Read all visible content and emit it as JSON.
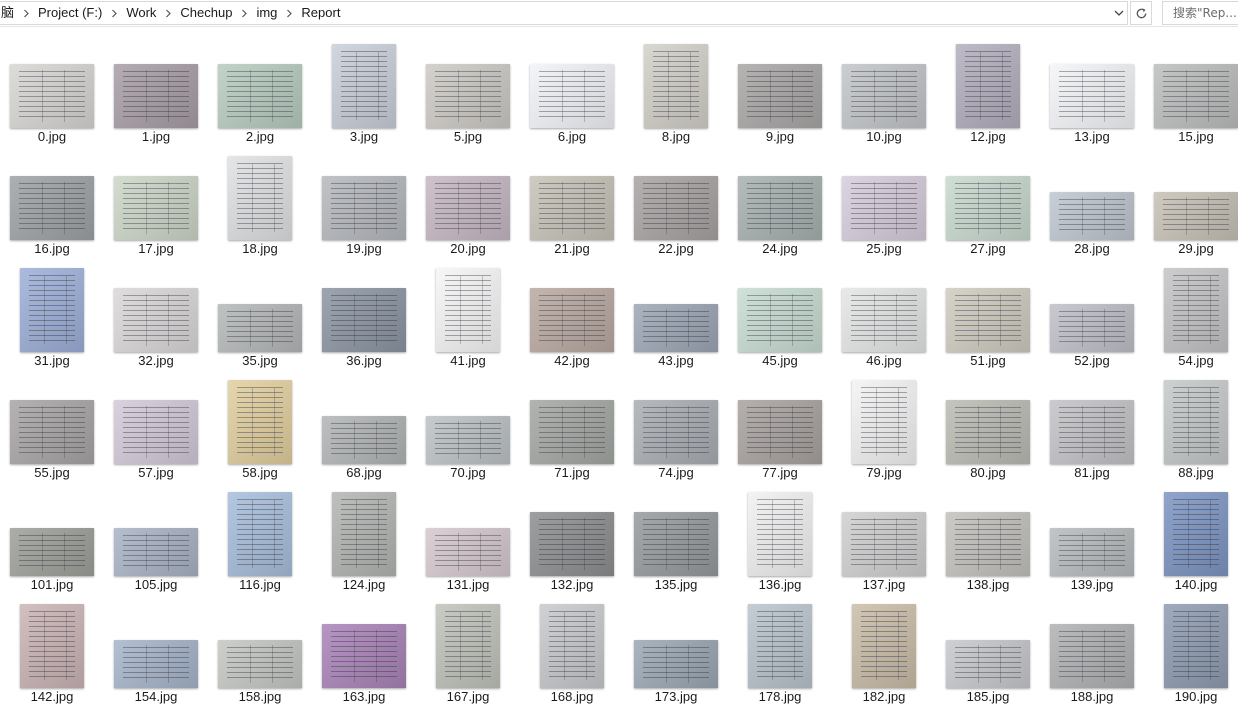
{
  "address_bar": {
    "breadcrumbs": [
      "脑",
      "Project (F:)",
      "Work",
      "Chechup",
      "img",
      "Report"
    ],
    "search_placeholder": "搜索\"Rep..."
  },
  "icons": {
    "separator": "chevron-right-icon",
    "dropdown": "chevron-down-icon",
    "refresh": "refresh-icon"
  },
  "files": [
    {
      "name": "0.jpg",
      "shape": "wide",
      "tone": "#d8d6d3"
    },
    {
      "name": "1.jpg",
      "shape": "wide",
      "tone": "#a79ea5"
    },
    {
      "name": "2.jpg",
      "shape": "wide",
      "tone": "#b7ccbf"
    },
    {
      "name": "3.jpg",
      "shape": "tall",
      "tone": "#c9cfd9"
    },
    {
      "name": "5.jpg",
      "shape": "wide",
      "tone": "#cdcac4"
    },
    {
      "name": "6.jpg",
      "shape": "wide",
      "tone": "#f1f3f8"
    },
    {
      "name": "8.jpg",
      "shape": "tall",
      "tone": "#d3d0c9"
    },
    {
      "name": "9.jpg",
      "shape": "wide",
      "tone": "#a9a7a6"
    },
    {
      "name": "10.jpg",
      "shape": "wide",
      "tone": "#c2c5c8"
    },
    {
      "name": "12.jpg",
      "shape": "tall",
      "tone": "#b4aebd"
    },
    {
      "name": "13.jpg",
      "shape": "wide",
      "tone": "#f4f5f8"
    },
    {
      "name": "15.jpg",
      "shape": "wide",
      "tone": "#bcbdbd"
    },
    {
      "name": "16.jpg",
      "shape": "wide",
      "tone": "#9ea2a5"
    },
    {
      "name": "17.jpg",
      "shape": "wide",
      "tone": "#ccd6c8"
    },
    {
      "name": "18.jpg",
      "shape": "tall",
      "tone": "#dfe1e3"
    },
    {
      "name": "19.jpg",
      "shape": "wide",
      "tone": "#b5b8bd"
    },
    {
      "name": "20.jpg",
      "shape": "wide",
      "tone": "#c5b8c3"
    },
    {
      "name": "21.jpg",
      "shape": "wide",
      "tone": "#c6c2b8"
    },
    {
      "name": "22.jpg",
      "shape": "wide",
      "tone": "#a8a3a2"
    },
    {
      "name": "24.jpg",
      "shape": "wide",
      "tone": "#a7b1b0"
    },
    {
      "name": "25.jpg",
      "shape": "wide",
      "tone": "#d7ccdc"
    },
    {
      "name": "27.jpg",
      "shape": "wide",
      "tone": "#c8d9cf"
    },
    {
      "name": "28.jpg",
      "shape": "short",
      "tone": "#bfc6cf"
    },
    {
      "name": "29.jpg",
      "shape": "short",
      "tone": "#c7c1b6"
    },
    {
      "name": "31.jpg",
      "shape": "tall",
      "tone": "#9dafd8"
    },
    {
      "name": "32.jpg",
      "shape": "wide",
      "tone": "#dad8d8"
    },
    {
      "name": "35.jpg",
      "shape": "short",
      "tone": "#b5b8b8"
    },
    {
      "name": "36.jpg",
      "shape": "wide",
      "tone": "#8c95a3"
    },
    {
      "name": "41.jpg",
      "shape": "tall",
      "tone": "#f6f6f6"
    },
    {
      "name": "42.jpg",
      "shape": "wide",
      "tone": "#b9a9a1"
    },
    {
      "name": "43.jpg",
      "shape": "short",
      "tone": "#9ca6b4"
    },
    {
      "name": "45.jpg",
      "shape": "wide",
      "tone": "#c8dcd2"
    },
    {
      "name": "46.jpg",
      "shape": "wide",
      "tone": "#e4e6e6"
    },
    {
      "name": "51.jpg",
      "shape": "wide",
      "tone": "#cfcbc0"
    },
    {
      "name": "52.jpg",
      "shape": "short",
      "tone": "#bfc0c8"
    },
    {
      "name": "54.jpg",
      "shape": "tall",
      "tone": "#c4c4c6"
    },
    {
      "name": "55.jpg",
      "shape": "wide",
      "tone": "#a9a5a6"
    },
    {
      "name": "57.jpg",
      "shape": "wide",
      "tone": "#d3c9d8"
    },
    {
      "name": "58.jpg",
      "shape": "tall",
      "tone": "#e2cf9f"
    },
    {
      "name": "68.jpg",
      "shape": "short",
      "tone": "#b2b5b5"
    },
    {
      "name": "70.jpg",
      "shape": "short",
      "tone": "#bcc2c4"
    },
    {
      "name": "71.jpg",
      "shape": "wide",
      "tone": "#a3a7a2"
    },
    {
      "name": "74.jpg",
      "shape": "wide",
      "tone": "#a9aeb4"
    },
    {
      "name": "77.jpg",
      "shape": "wide",
      "tone": "#a8a29f"
    },
    {
      "name": "79.jpg",
      "shape": "tall",
      "tone": "#f3f3f3"
    },
    {
      "name": "80.jpg",
      "shape": "wide",
      "tone": "#b9bbb3"
    },
    {
      "name": "81.jpg",
      "shape": "wide",
      "tone": "#c3c2c6"
    },
    {
      "name": "88.jpg",
      "shape": "tall",
      "tone": "#c5c9c9"
    },
    {
      "name": "101.jpg",
      "shape": "short",
      "tone": "#9da099"
    },
    {
      "name": "105.jpg",
      "shape": "short",
      "tone": "#a9b3c4"
    },
    {
      "name": "116.jpg",
      "shape": "tall",
      "tone": "#a8bedb"
    },
    {
      "name": "124.jpg",
      "shape": "tall",
      "tone": "#b2b5b1"
    },
    {
      "name": "131.jpg",
      "shape": "short",
      "tone": "#d4c8cf"
    },
    {
      "name": "132.jpg",
      "shape": "wide",
      "tone": "#8c8e90"
    },
    {
      "name": "135.jpg",
      "shape": "wide",
      "tone": "#959a9d"
    },
    {
      "name": "136.jpg",
      "shape": "tall",
      "tone": "#f1f1f1"
    },
    {
      "name": "137.jpg",
      "shape": "wide",
      "tone": "#cfcfcf"
    },
    {
      "name": "138.jpg",
      "shape": "wide",
      "tone": "#c3c1bd"
    },
    {
      "name": "139.jpg",
      "shape": "short",
      "tone": "#b7bbbd"
    },
    {
      "name": "140.jpg",
      "shape": "tall",
      "tone": "#7d95c2"
    },
    {
      "name": "142.jpg",
      "shape": "tall",
      "tone": "#cbb4b5"
    },
    {
      "name": "154.jpg",
      "shape": "short",
      "tone": "#a6b4ca"
    },
    {
      "name": "158.jpg",
      "shape": "short",
      "tone": "#c5c7c3"
    },
    {
      "name": "163.jpg",
      "shape": "wide",
      "tone": "#a983b8"
    },
    {
      "name": "167.jpg",
      "shape": "tall",
      "tone": "#bfc3ba"
    },
    {
      "name": "168.jpg",
      "shape": "tall",
      "tone": "#c7c9cc"
    },
    {
      "name": "173.jpg",
      "shape": "short",
      "tone": "#9ba7b3"
    },
    {
      "name": "178.jpg",
      "shape": "tall",
      "tone": "#b9c4cb"
    },
    {
      "name": "182.jpg",
      "shape": "tall",
      "tone": "#cabca8"
    },
    {
      "name": "185.jpg",
      "shape": "short",
      "tone": "#c6c8cc"
    },
    {
      "name": "188.jpg",
      "shape": "wide",
      "tone": "#b0b1b3"
    },
    {
      "name": "190.jpg",
      "shape": "tall",
      "tone": "#8f9db2"
    }
  ]
}
